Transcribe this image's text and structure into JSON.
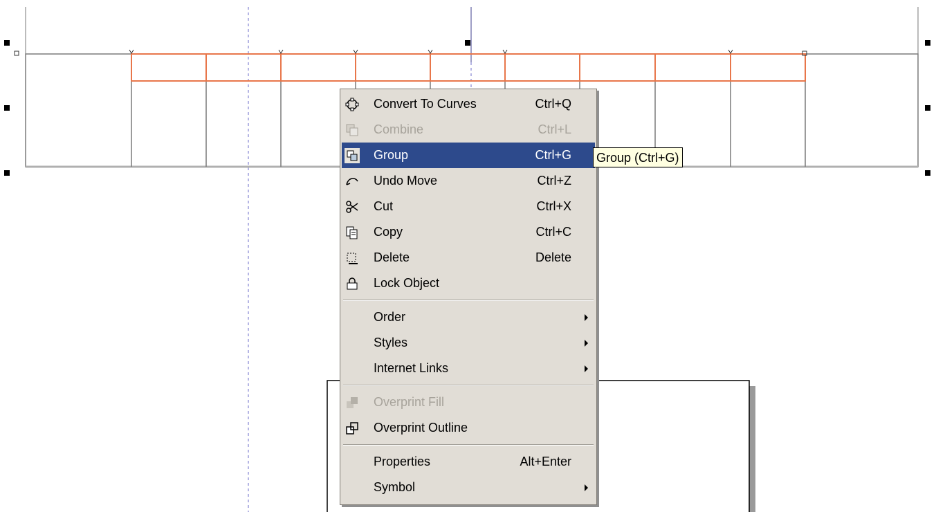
{
  "context_menu": {
    "groups": [
      [
        {
          "label": "Convert To Curves",
          "shortcut": "Ctrl+Q",
          "icon": "convert-curves-icon",
          "disabled": false,
          "submenu": false
        },
        {
          "label": "Combine",
          "shortcut": "Ctrl+L",
          "icon": "combine-icon",
          "disabled": true,
          "submenu": false
        },
        {
          "label": "Group",
          "shortcut": "Ctrl+G",
          "icon": "group-icon",
          "disabled": false,
          "submenu": false,
          "highlighted": true
        },
        {
          "label": "Undo Move",
          "shortcut": "Ctrl+Z",
          "icon": "undo-move-icon",
          "disabled": false,
          "submenu": false
        },
        {
          "label": "Cut",
          "shortcut": "Ctrl+X",
          "icon": "scissors-icon",
          "disabled": false,
          "submenu": false
        },
        {
          "label": "Copy",
          "shortcut": "Ctrl+C",
          "icon": "copy-icon",
          "disabled": false,
          "submenu": false
        },
        {
          "label": "Delete",
          "shortcut": "Delete",
          "icon": "delete-icon",
          "disabled": false,
          "submenu": false
        },
        {
          "label": "Lock Object",
          "shortcut": "",
          "icon": "lock-icon",
          "disabled": false,
          "submenu": false
        }
      ],
      [
        {
          "label": "Order",
          "shortcut": "",
          "icon": "",
          "disabled": false,
          "submenu": true
        },
        {
          "label": "Styles",
          "shortcut": "",
          "icon": "",
          "disabled": false,
          "submenu": true
        },
        {
          "label": "Internet Links",
          "shortcut": "",
          "icon": "",
          "disabled": false,
          "submenu": true
        }
      ],
      [
        {
          "label": "Overprint Fill",
          "shortcut": "",
          "icon": "overprint-fill-icon",
          "disabled": true,
          "submenu": false
        },
        {
          "label": "Overprint Outline",
          "shortcut": "",
          "icon": "overprint-outline-icon",
          "disabled": false,
          "submenu": false
        }
      ],
      [
        {
          "label": "Properties",
          "shortcut": "Alt+Enter",
          "icon": "",
          "disabled": false,
          "submenu": false
        },
        {
          "label": "Symbol",
          "shortcut": "",
          "icon": "",
          "disabled": false,
          "submenu": true
        }
      ]
    ]
  },
  "tooltip": {
    "text": "Group (Ctrl+G)"
  },
  "colors": {
    "menu_bg": "#e1ddd6",
    "highlight": "#2d4a8c",
    "selection_outline": "#e8764a",
    "tooltip_bg": "#ffffe1",
    "guide": "#6b6bc8"
  }
}
